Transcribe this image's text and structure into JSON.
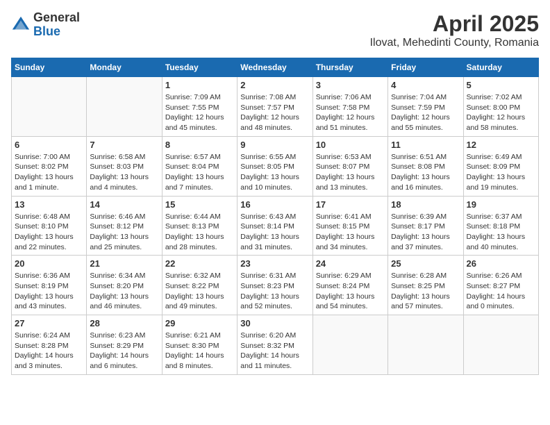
{
  "logo": {
    "general": "General",
    "blue": "Blue"
  },
  "title": "April 2025",
  "subtitle": "Ilovat, Mehedinti County, Romania",
  "weekdays": [
    "Sunday",
    "Monday",
    "Tuesday",
    "Wednesday",
    "Thursday",
    "Friday",
    "Saturday"
  ],
  "weeks": [
    [
      {
        "day": "",
        "info": ""
      },
      {
        "day": "",
        "info": ""
      },
      {
        "day": "1",
        "info": "Sunrise: 7:09 AM\nSunset: 7:55 PM\nDaylight: 12 hours and 45 minutes."
      },
      {
        "day": "2",
        "info": "Sunrise: 7:08 AM\nSunset: 7:57 PM\nDaylight: 12 hours and 48 minutes."
      },
      {
        "day": "3",
        "info": "Sunrise: 7:06 AM\nSunset: 7:58 PM\nDaylight: 12 hours and 51 minutes."
      },
      {
        "day": "4",
        "info": "Sunrise: 7:04 AM\nSunset: 7:59 PM\nDaylight: 12 hours and 55 minutes."
      },
      {
        "day": "5",
        "info": "Sunrise: 7:02 AM\nSunset: 8:00 PM\nDaylight: 12 hours and 58 minutes."
      }
    ],
    [
      {
        "day": "6",
        "info": "Sunrise: 7:00 AM\nSunset: 8:02 PM\nDaylight: 13 hours and 1 minute."
      },
      {
        "day": "7",
        "info": "Sunrise: 6:58 AM\nSunset: 8:03 PM\nDaylight: 13 hours and 4 minutes."
      },
      {
        "day": "8",
        "info": "Sunrise: 6:57 AM\nSunset: 8:04 PM\nDaylight: 13 hours and 7 minutes."
      },
      {
        "day": "9",
        "info": "Sunrise: 6:55 AM\nSunset: 8:05 PM\nDaylight: 13 hours and 10 minutes."
      },
      {
        "day": "10",
        "info": "Sunrise: 6:53 AM\nSunset: 8:07 PM\nDaylight: 13 hours and 13 minutes."
      },
      {
        "day": "11",
        "info": "Sunrise: 6:51 AM\nSunset: 8:08 PM\nDaylight: 13 hours and 16 minutes."
      },
      {
        "day": "12",
        "info": "Sunrise: 6:49 AM\nSunset: 8:09 PM\nDaylight: 13 hours and 19 minutes."
      }
    ],
    [
      {
        "day": "13",
        "info": "Sunrise: 6:48 AM\nSunset: 8:10 PM\nDaylight: 13 hours and 22 minutes."
      },
      {
        "day": "14",
        "info": "Sunrise: 6:46 AM\nSunset: 8:12 PM\nDaylight: 13 hours and 25 minutes."
      },
      {
        "day": "15",
        "info": "Sunrise: 6:44 AM\nSunset: 8:13 PM\nDaylight: 13 hours and 28 minutes."
      },
      {
        "day": "16",
        "info": "Sunrise: 6:43 AM\nSunset: 8:14 PM\nDaylight: 13 hours and 31 minutes."
      },
      {
        "day": "17",
        "info": "Sunrise: 6:41 AM\nSunset: 8:15 PM\nDaylight: 13 hours and 34 minutes."
      },
      {
        "day": "18",
        "info": "Sunrise: 6:39 AM\nSunset: 8:17 PM\nDaylight: 13 hours and 37 minutes."
      },
      {
        "day": "19",
        "info": "Sunrise: 6:37 AM\nSunset: 8:18 PM\nDaylight: 13 hours and 40 minutes."
      }
    ],
    [
      {
        "day": "20",
        "info": "Sunrise: 6:36 AM\nSunset: 8:19 PM\nDaylight: 13 hours and 43 minutes."
      },
      {
        "day": "21",
        "info": "Sunrise: 6:34 AM\nSunset: 8:20 PM\nDaylight: 13 hours and 46 minutes."
      },
      {
        "day": "22",
        "info": "Sunrise: 6:32 AM\nSunset: 8:22 PM\nDaylight: 13 hours and 49 minutes."
      },
      {
        "day": "23",
        "info": "Sunrise: 6:31 AM\nSunset: 8:23 PM\nDaylight: 13 hours and 52 minutes."
      },
      {
        "day": "24",
        "info": "Sunrise: 6:29 AM\nSunset: 8:24 PM\nDaylight: 13 hours and 54 minutes."
      },
      {
        "day": "25",
        "info": "Sunrise: 6:28 AM\nSunset: 8:25 PM\nDaylight: 13 hours and 57 minutes."
      },
      {
        "day": "26",
        "info": "Sunrise: 6:26 AM\nSunset: 8:27 PM\nDaylight: 14 hours and 0 minutes."
      }
    ],
    [
      {
        "day": "27",
        "info": "Sunrise: 6:24 AM\nSunset: 8:28 PM\nDaylight: 14 hours and 3 minutes."
      },
      {
        "day": "28",
        "info": "Sunrise: 6:23 AM\nSunset: 8:29 PM\nDaylight: 14 hours and 6 minutes."
      },
      {
        "day": "29",
        "info": "Sunrise: 6:21 AM\nSunset: 8:30 PM\nDaylight: 14 hours and 8 minutes."
      },
      {
        "day": "30",
        "info": "Sunrise: 6:20 AM\nSunset: 8:32 PM\nDaylight: 14 hours and 11 minutes."
      },
      {
        "day": "",
        "info": ""
      },
      {
        "day": "",
        "info": ""
      },
      {
        "day": "",
        "info": ""
      }
    ]
  ]
}
